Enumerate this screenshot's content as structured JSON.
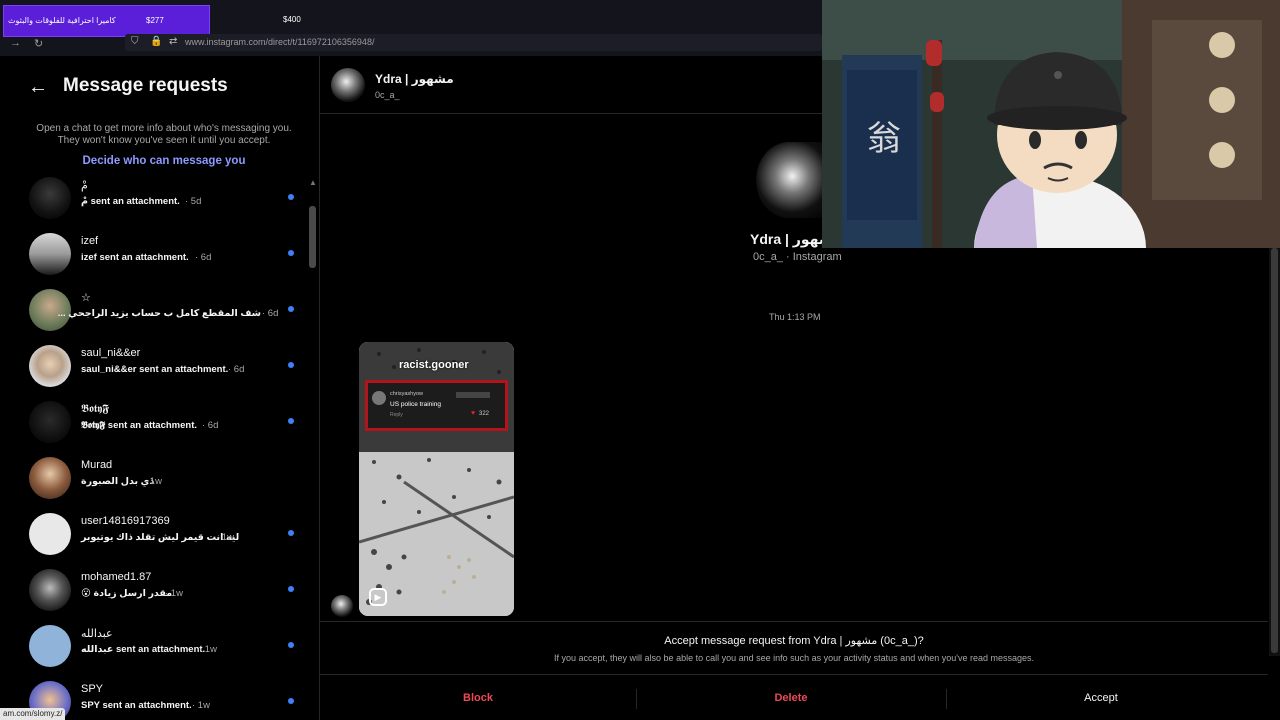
{
  "browser": {
    "promo_text": "كاميرا احترافية للفلوقات والبثوث",
    "promo_price": "$277",
    "price2": "$400",
    "url": "www.instagram.com/direct/t/116972106356948/",
    "status_url": "am.com/slomy.z/"
  },
  "sidebar": {
    "title": "Message requests",
    "info": "Open a chat to get more info about who's messaging you. They won't know you've seen it until you accept.",
    "decide_link": "Decide who can message you",
    "requests": [
      {
        "name": "مْ",
        "preview": "مْ sent an attachment.",
        "time": "· 5d",
        "unread": true
      },
      {
        "name": "izef",
        "preview": "izef sent an attachment.",
        "time": "· 6d",
        "unread": true
      },
      {
        "name": "☆",
        "preview": "شف المقطع كامل ب حساب يزيد الراجحي ...",
        "time": "· 6d",
        "unread": true
      },
      {
        "name": "saul_ni&&er",
        "preview": "saul_ni&&er sent an attachment.",
        "time": "· 6d",
        "unread": true
      },
      {
        "name": "𝕭𝖔𝖙𝖞𝕱",
        "preview": "𝕭𝖔𝖙𝖞𝕱 sent an attachment.",
        "time": "· 6d",
        "unread": true
      },
      {
        "name": "Murad",
        "preview": "ذي بدل الصبورة",
        "time": "· 1w",
        "unread": false
      },
      {
        "name": "user14816917369",
        "preview": "ليه انت قيمر ليش تقلد ذاك يوتيوبر",
        "time": "· 1w",
        "unread": true
      },
      {
        "name": "mohamed1.87",
        "preview": "😮 مقدر ارسل زيادة",
        "time": "· 1w",
        "unread": true
      },
      {
        "name": "عبدالله",
        "preview": "عبدالله sent an attachment.",
        "time": "· 1w",
        "unread": true
      },
      {
        "name": "SPY",
        "preview": "SPY sent an attachment.",
        "time": "· 1w",
        "unread": true
      }
    ]
  },
  "chat": {
    "header_name": "Ydra | مشهور",
    "header_user": "0c_a_",
    "profile_name": "Ydra | مشهور",
    "profile_sub": "0c_a_ · Instagram",
    "timestamp": "Thu 1:13 PM",
    "reel": {
      "author": "racist.gooner",
      "comment_user": "chrisyashyow",
      "comment_text": "US police training",
      "comment_reply": "Reply",
      "comment_likes": "322"
    }
  },
  "accept": {
    "question": "Accept message request from Ydra | مشهور (0c_a_)?",
    "description": "If you accept, they will also be able to call you and see info such as your activity status and when you've read messages.",
    "block": "Block",
    "delete": "Delete",
    "accept": "Accept",
    "colors": {
      "danger": "#ed4956",
      "primary": "#f5f5f5"
    }
  }
}
